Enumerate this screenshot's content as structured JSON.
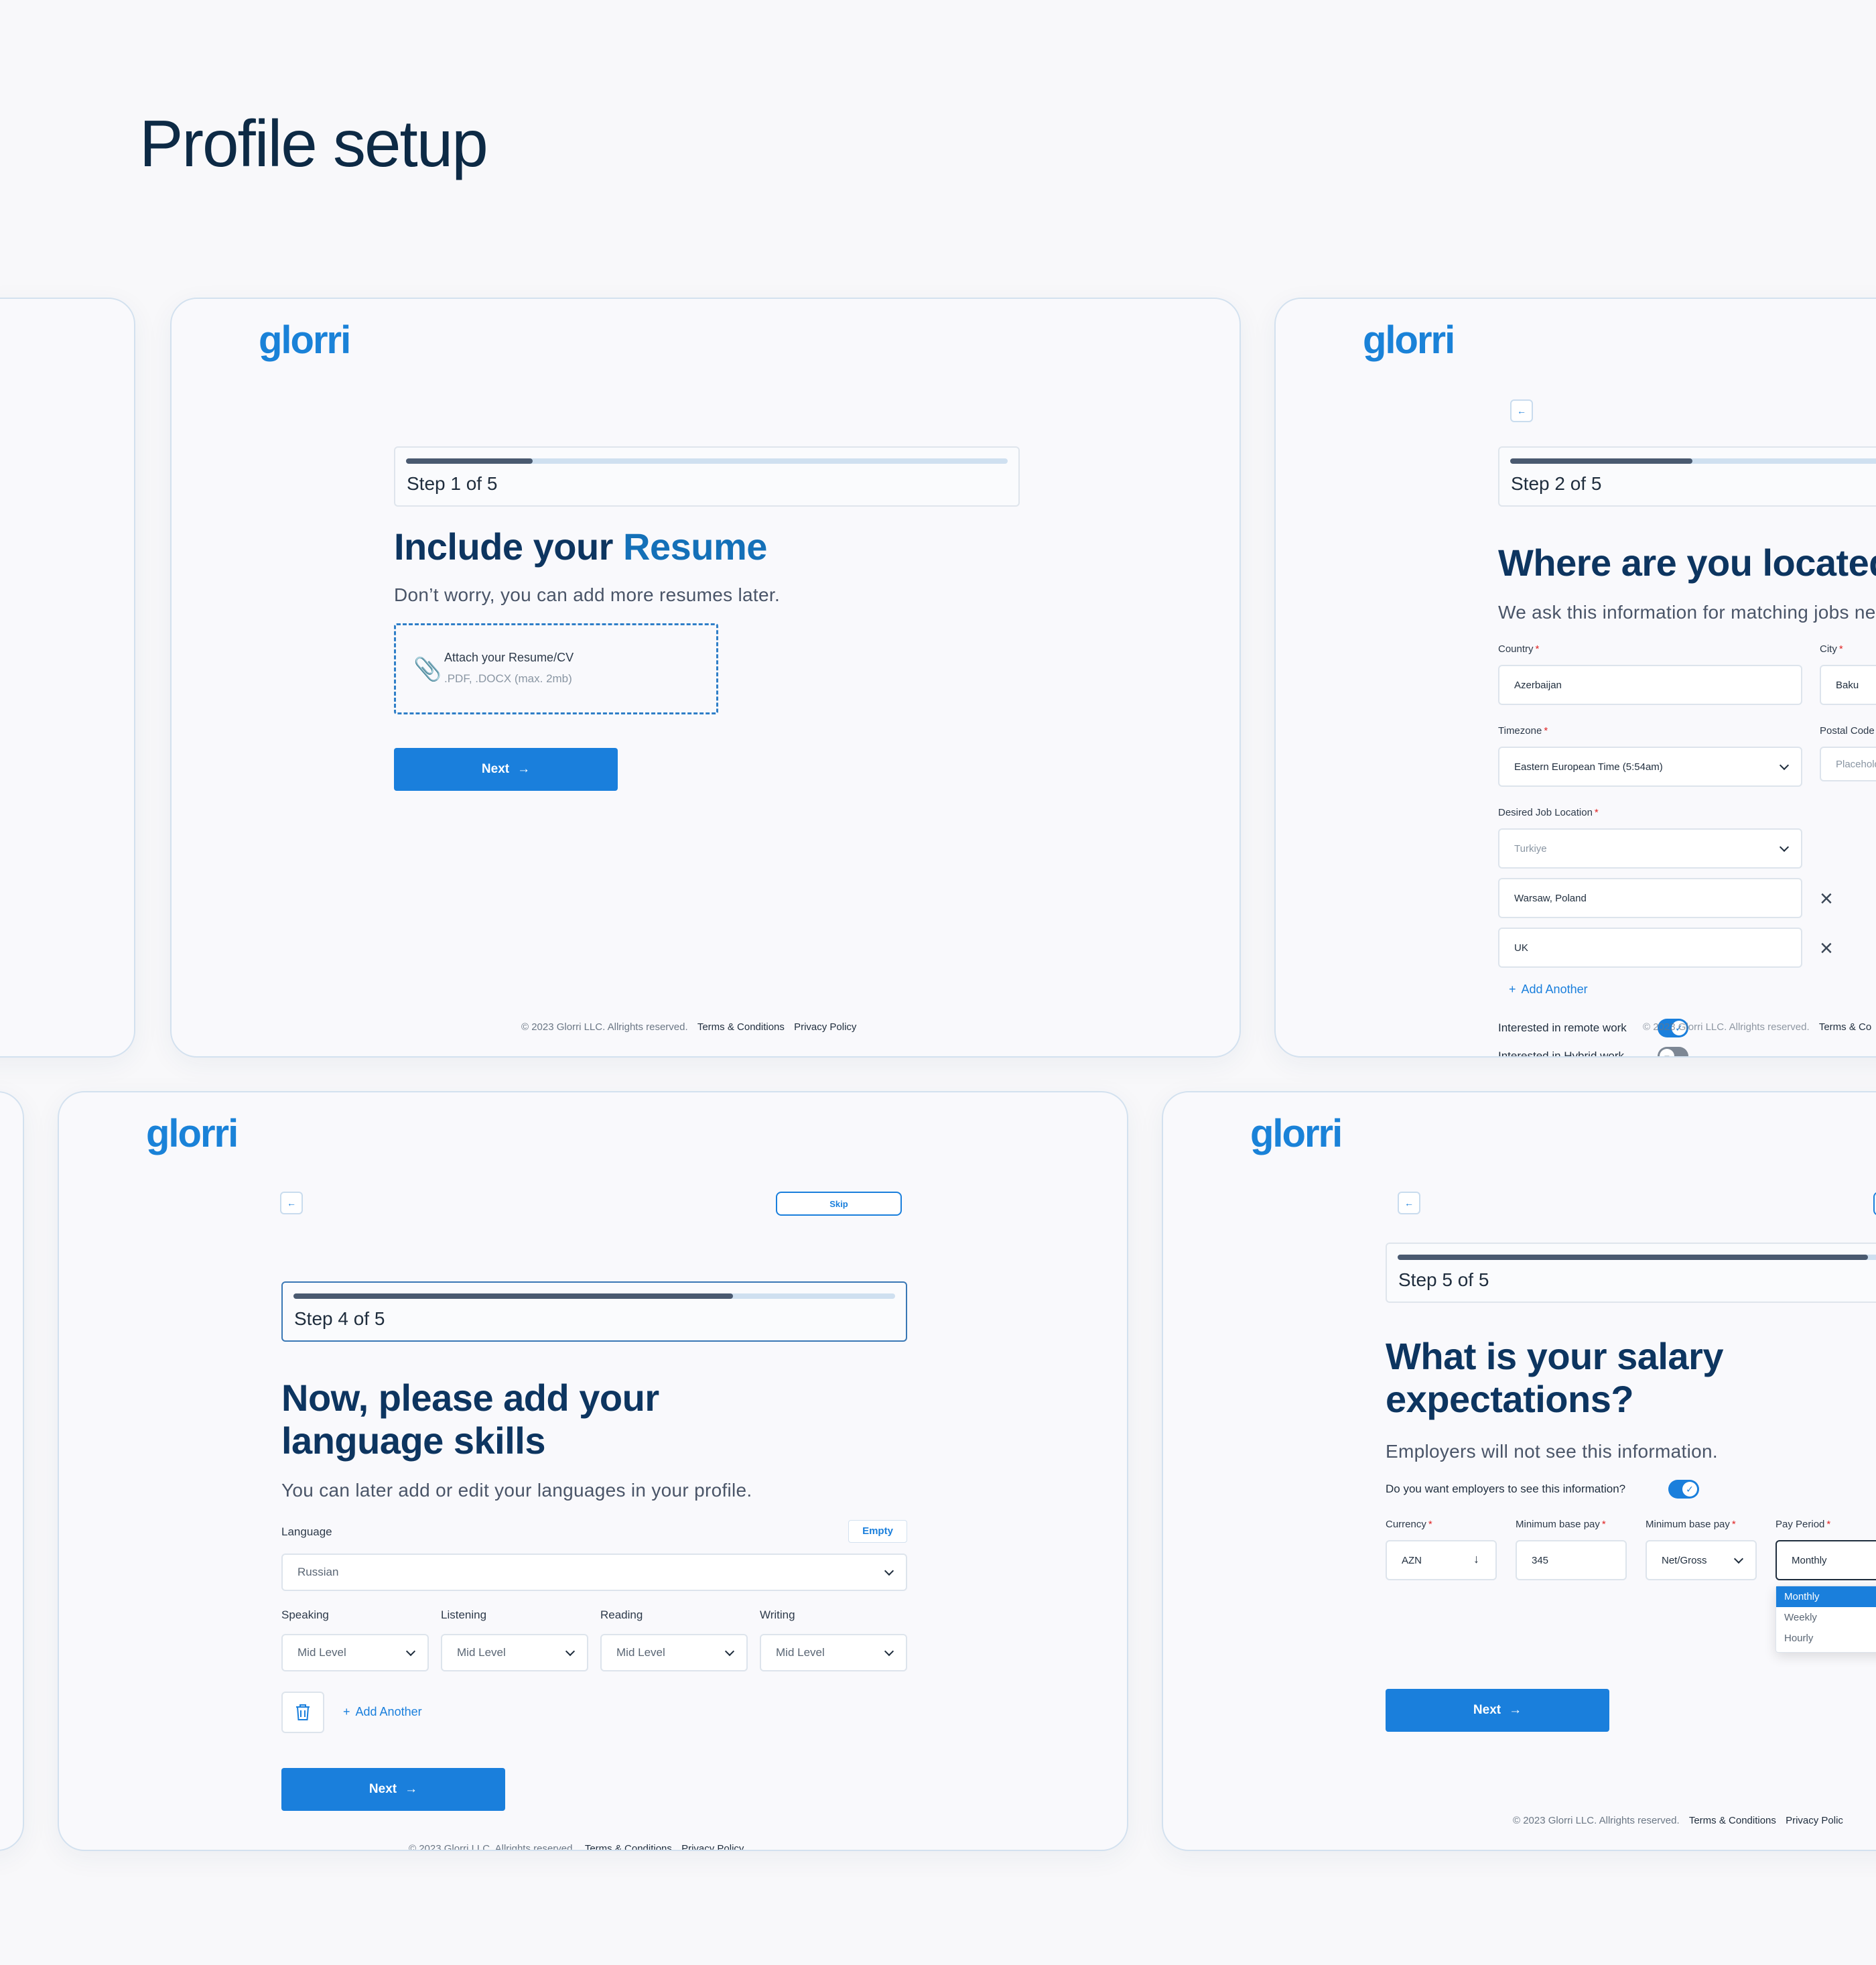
{
  "page": {
    "title": "Profile setup"
  },
  "brand": {
    "logo": "glorri",
    "accent": "#1a7fdc",
    "dark": "#0d3560"
  },
  "footer": {
    "copyright": "© 2023 Glorri LLC. Allrights reserved.",
    "terms": "Terms & Conditions",
    "privacy": "Privacy Policy"
  },
  "step1": {
    "step": "Step 1 of 5",
    "progress": 0.21,
    "title_a": "Include your ",
    "title_b": "Resume",
    "subtitle": "Don’t worry, you can add more resumes later.",
    "attach_label": "Attach your Resume/CV",
    "attach_hint": ".PDF, .DOCX (max. 2mb)",
    "next": "Next"
  },
  "step2": {
    "step": "Step 2 of 5",
    "progress": 0.4,
    "title": "Where are you located?",
    "subtitle": "We ask this information for matching jobs near you.",
    "country_label": "Country",
    "country_value": "Azerbaijan",
    "city_label": "City",
    "city_value": "Baku",
    "timezone_label": "Timezone",
    "timezone_value": "Eastern European Time (5:54am)",
    "postal_label": "Postal Code",
    "postal_placeholder": "Placeholder",
    "desired_label": "Desired Job Location",
    "desired_placeholder": "Turkiye",
    "locations": [
      "Warsaw, Poland",
      "UK"
    ],
    "add_another": "Add Another",
    "remote_label": "Interested in remote work",
    "hybrid_label": "Interested in Hybrid work",
    "footer_partial": "© 2023 Glorri LLC. Allrights reserved.",
    "terms_partial": "Terms & Co"
  },
  "step4": {
    "step": "Step 4 of 5",
    "progress": 0.73,
    "skip": "Skip",
    "title_line1": "Now, please add your",
    "title_line2": "language skills",
    "subtitle": "You can later add or edit your languages in your profile.",
    "language_label": "Language",
    "empty_badge": "Empty",
    "language_value": "Russian",
    "skills": [
      {
        "label": "Speaking",
        "value": "Mid Level"
      },
      {
        "label": "Listening",
        "value": "Mid Level"
      },
      {
        "label": "Reading",
        "value": "Mid Level"
      },
      {
        "label": "Writing",
        "value": "Mid Level"
      }
    ],
    "add_another": "Add Another",
    "next": "Next"
  },
  "step5": {
    "step": "Step 5 of 5",
    "progress": 0.9,
    "title_line1": "What is your salary",
    "title_line2": "expectations?",
    "subtitle": "Employers will not see this information.",
    "toggle_question": "Do you want employers to see this information?",
    "currency_label": "Currency",
    "currency_value": "AZN",
    "min_pay_label": "Minimum base pay",
    "min_pay_value": "345",
    "min_pay2_label": "Minimum base pay",
    "min_pay2_value": "Net/Gross",
    "period_label": "Pay Period",
    "period_value": "Monthly",
    "period_options": [
      "Monthly",
      "Weekly",
      "Hourly"
    ],
    "next": "Next",
    "footer_privacy": "Privacy Polic"
  }
}
